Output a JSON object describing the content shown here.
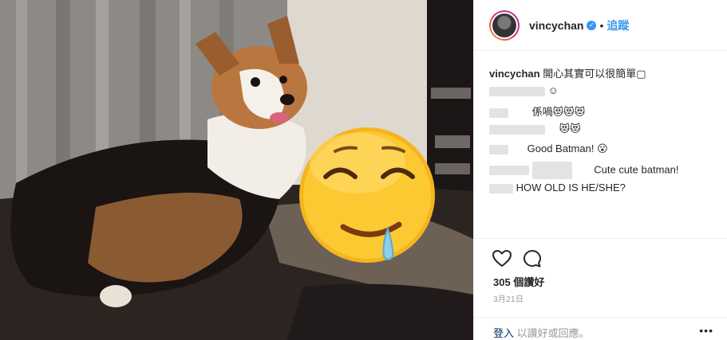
{
  "header": {
    "username": "vincychan",
    "verified_glyph": "✓",
    "separator": "•",
    "follow_label": "追蹤"
  },
  "caption": {
    "author": "vincychan",
    "text": "開心其實可以很簡單▢"
  },
  "comments": [
    {
      "text": "☺"
    },
    {
      "text": "係喎😻😻😻"
    },
    {
      "text": "😻😻"
    },
    {
      "text": "Good Batman! 😮"
    },
    {
      "text": "Cute cute batman!"
    },
    {
      "text": "HOW OLD IS HE/SHE?"
    }
  ],
  "actions": {
    "like_icon": "heart-icon",
    "comment_icon": "comment-icon",
    "likes_count": "305",
    "likes_suffix": "個讚好",
    "date": "3月21日"
  },
  "login": {
    "link_label": "登入",
    "rest_text": "以讚好或回應。",
    "more_glyph": "•••"
  },
  "colors": {
    "link_blue": "#3897f0",
    "muted": "#999999",
    "text": "#262626"
  }
}
